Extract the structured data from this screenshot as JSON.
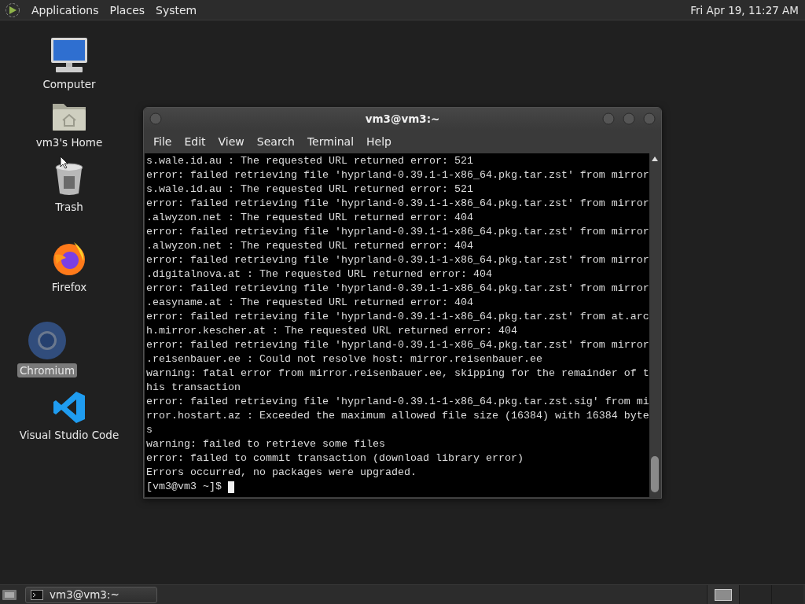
{
  "top_panel": {
    "menus": [
      {
        "label": "Applications"
      },
      {
        "label": "Places"
      },
      {
        "label": "System"
      }
    ],
    "clock": "Fri Apr 19, 11:27 AM"
  },
  "desktop_icons": [
    {
      "kind": "computer",
      "label": "Computer",
      "selected": false
    },
    {
      "kind": "home",
      "label": "vm3's Home",
      "selected": false
    },
    {
      "kind": "trash",
      "label": "Trash",
      "selected": false
    },
    {
      "kind": "firefox",
      "label": "Firefox",
      "selected": false
    },
    {
      "kind": "chromium",
      "label": "Chromium",
      "selected": true
    },
    {
      "kind": "vscode",
      "label": "Visual Studio Code",
      "selected": false
    }
  ],
  "terminal_window": {
    "title": "vm3@vm3:~",
    "menu": [
      "File",
      "Edit",
      "View",
      "Search",
      "Terminal",
      "Help"
    ],
    "lines": [
      "s.wale.id.au : The requested URL returned error: 521",
      "error: failed retrieving file 'hyprland-0.39.1-1-x86_64.pkg.tar.zst' from mirror",
      "s.wale.id.au : The requested URL returned error: 521",
      "error: failed retrieving file 'hyprland-0.39.1-1-x86_64.pkg.tar.zst' from mirror",
      ".alwyzon.net : The requested URL returned error: 404",
      "error: failed retrieving file 'hyprland-0.39.1-1-x86_64.pkg.tar.zst' from mirror",
      ".alwyzon.net : The requested URL returned error: 404",
      "error: failed retrieving file 'hyprland-0.39.1-1-x86_64.pkg.tar.zst' from mirror",
      ".digitalnova.at : The requested URL returned error: 404",
      "error: failed retrieving file 'hyprland-0.39.1-1-x86_64.pkg.tar.zst' from mirror",
      ".easyname.at : The requested URL returned error: 404",
      "error: failed retrieving file 'hyprland-0.39.1-1-x86_64.pkg.tar.zst' from at.arc",
      "h.mirror.kescher.at : The requested URL returned error: 404",
      "error: failed retrieving file 'hyprland-0.39.1-1-x86_64.pkg.tar.zst' from mirror",
      ".reisenbauer.ee : Could not resolve host: mirror.reisenbauer.ee",
      "warning: fatal error from mirror.reisenbauer.ee, skipping for the remainder of t",
      "his transaction",
      "error: failed retrieving file 'hyprland-0.39.1-1-x86_64.pkg.tar.zst.sig' from mi",
      "rror.hostart.az : Exceeded the maximum allowed file size (16384) with 16384 byte",
      "s",
      "warning: failed to retrieve some files",
      "error: failed to commit transaction (download library error)",
      "Errors occurred, no packages were upgraded."
    ],
    "prompt": "[vm3@vm3 ~]$"
  },
  "bottom_panel": {
    "tasks": [
      {
        "label": "vm3@vm3:~",
        "selected": false
      }
    ],
    "workspaces": [
      {
        "selected": true
      },
      {
        "selected": false
      },
      {
        "selected": false
      }
    ]
  }
}
